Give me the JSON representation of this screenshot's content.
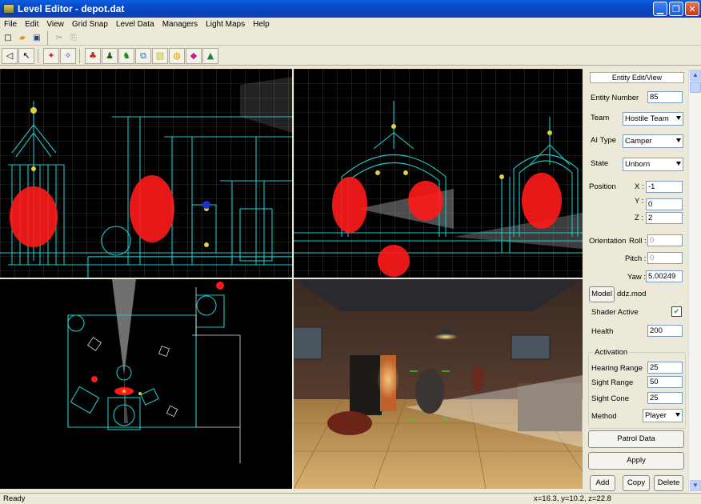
{
  "window": {
    "title": "Level Editor - depot.dat"
  },
  "menu": [
    "File",
    "Edit",
    "View",
    "Grid Snap",
    "Level Data",
    "Managers",
    "Light Maps",
    "Help"
  ],
  "toolbar1": [
    {
      "icon": "new-file-icon",
      "glyph": "□"
    },
    {
      "icon": "open-folder-icon",
      "glyph": "▰"
    },
    {
      "icon": "save-icon",
      "glyph": "▣"
    },
    {
      "icon": "cut-icon",
      "glyph": "✂"
    },
    {
      "icon": "copy-icon",
      "glyph": "⎘"
    }
  ],
  "toolbar2": [
    {
      "icon": "arrow-left-icon",
      "glyph": "◁"
    },
    {
      "icon": "select-pointer-icon",
      "glyph": "↖"
    },
    {
      "icon": "vertex-icon",
      "glyph": "✦"
    },
    {
      "icon": "vertex-alt-icon",
      "glyph": "✧"
    },
    {
      "icon": "character-icon",
      "glyph": "♣"
    },
    {
      "icon": "person-icon",
      "glyph": "♟"
    },
    {
      "icon": "entity-icon",
      "glyph": "♞"
    },
    {
      "icon": "pipe-icon",
      "glyph": "⧉"
    },
    {
      "icon": "brush-icon",
      "glyph": "▧"
    },
    {
      "icon": "light-icon",
      "glyph": "◍"
    },
    {
      "icon": "gem-icon",
      "glyph": "◆"
    },
    {
      "icon": "landscape-icon",
      "glyph": "▲"
    }
  ],
  "panel": {
    "title": "Entity Edit/View",
    "entity_number_label": "Entity Number",
    "entity_number": "85",
    "team_label": "Team",
    "team": "Hostile Team",
    "ai_type_label": "AI Type",
    "ai_type": "Camper",
    "state_label": "State",
    "state": "Unborn",
    "position_label": "Position",
    "x_label": "X :",
    "x": "-1",
    "y_label": "Y :",
    "y": "0",
    "z_label": "Z :",
    "z": "2",
    "orientation_label": "Orientation",
    "roll_label": "Roll :",
    "roll": "0",
    "pitch_label": "Pitch :",
    "pitch": "0",
    "yaw_label": "Yaw :",
    "yaw": "5.00249",
    "model_button": "Model",
    "model_file": "ddz.mod",
    "shader_label": "Shader Active",
    "shader_check": "✔",
    "health_label": "Health",
    "health": "200",
    "activation_label": "Activation",
    "hearing_label": "Hearing Range",
    "hearing": "25",
    "sight_range_label": "Sight Range",
    "sight_range": "50",
    "sight_cone_label": "Sight Cone",
    "sight_cone": "25",
    "method_label": "Method",
    "method": "Player",
    "patrol_button": "Patrol Data",
    "apply_button": "Apply",
    "add_button": "Add",
    "copy_button": "Copy",
    "delete_button": "Delete"
  },
  "status": {
    "text": "Ready",
    "coords": "x=16.3, y=10.2, z=22.8"
  },
  "colors": {
    "wire": "#1fc6c6",
    "entity": "#ff1a1a",
    "grid": "#5a5a5a",
    "titlebar": "#0a4fd0"
  }
}
